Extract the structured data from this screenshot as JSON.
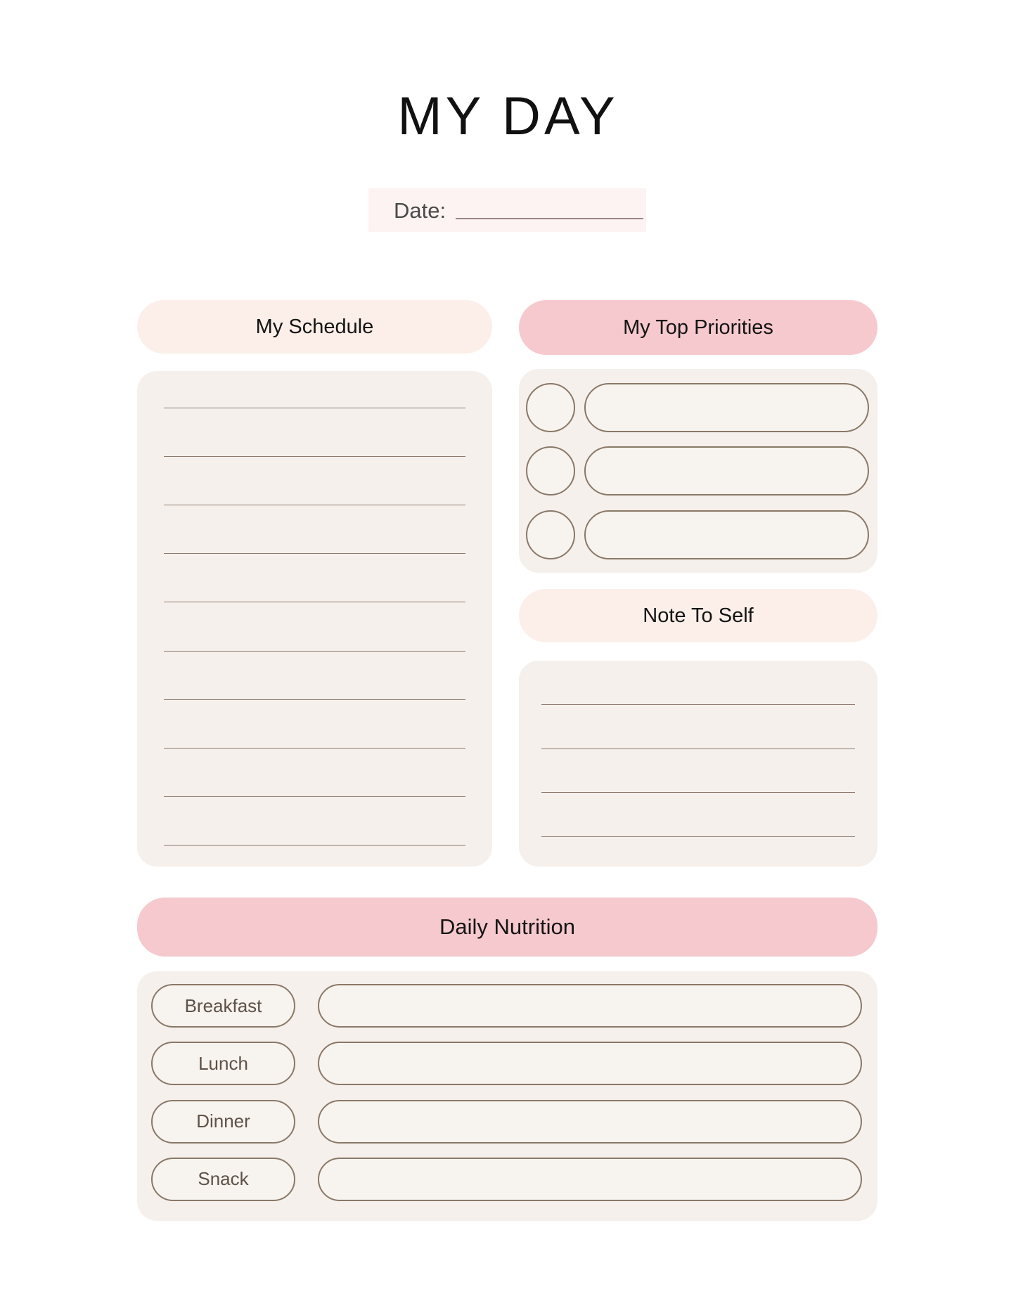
{
  "page": {
    "title": "MY DAY",
    "background_color": "#ffffff"
  },
  "date_field": {
    "label": "Date:",
    "value": "",
    "placeholder": "",
    "background_color": "#fdf3f2"
  },
  "colors": {
    "peach_header": "#fcefe9",
    "pink_header": "#f6c9ce",
    "panel_cream": "#f5f0ec",
    "outline_brown": "#8a7866",
    "rule_brown": "#8e7a6d",
    "label_text": "#5e5146"
  },
  "schedule": {
    "header": "My Schedule",
    "header_color": "#fcefe9",
    "line_count": 10,
    "lines": [
      "",
      "",
      "",
      "",
      "",
      "",
      "",
      "",
      "",
      ""
    ]
  },
  "priorities": {
    "header": "My Top Priorities",
    "header_color": "#f6c9ce",
    "items": [
      {
        "checked": false,
        "text": ""
      },
      {
        "checked": false,
        "text": ""
      },
      {
        "checked": false,
        "text": ""
      }
    ]
  },
  "note_to_self": {
    "header": "Note To Self",
    "header_color": "#fcefe9",
    "line_count": 4,
    "lines": [
      "",
      "",
      "",
      ""
    ]
  },
  "daily_nutrition": {
    "header": "Daily Nutrition",
    "header_color": "#f6c9ce",
    "meals": [
      {
        "label": "Breakfast",
        "value": ""
      },
      {
        "label": "Lunch",
        "value": ""
      },
      {
        "label": "Dinner",
        "value": ""
      },
      {
        "label": "Snack",
        "value": ""
      }
    ]
  }
}
